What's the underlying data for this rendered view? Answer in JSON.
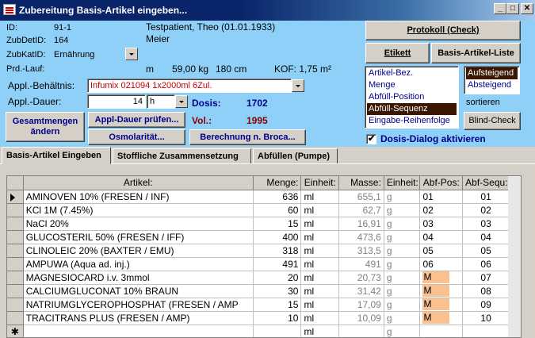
{
  "window": {
    "title": "Zubereitung Basis-Artikel eingeben...",
    "minimize": "_",
    "maximize": "□",
    "close": "✕"
  },
  "patient": {
    "id_label": "ID:",
    "id_value": "91-1",
    "name": "Testpatient, Theo (01.01.1933)",
    "zubdet_label": "ZubDetID:",
    "zubdet_value": "164",
    "doctor": "Meier",
    "zubkat_label": "ZubKatID:",
    "zubkat_value": "Ernährung",
    "prdlauf_label": "Prd.-Lauf:",
    "unit_m": "m",
    "weight": "59,00 kg",
    "height": "180 cm",
    "kof": "KOF: 1,75 m²"
  },
  "appl": {
    "behaeltnis_label": "Appl.-Behältnis:",
    "behaeltnis_value": "Infumix 021094 1x2000ml 6Zul.",
    "dauer_label": "Appl.-Dauer:",
    "dauer_value": "14",
    "dauer_unit": "h",
    "dosis_label": "Dosis:",
    "dosis_value": "1702",
    "vol_label": "Vol.:",
    "vol_value": "1995"
  },
  "buttons": {
    "gesamtmengen": "Gesamtmengen ändern",
    "appl_dauer": "Appl-Dauer prüfen...",
    "osmolaritaet": "Osmolarität...",
    "berechnung": "Berechnung n. Broca...",
    "protokoll": "Protokoll (Check)",
    "etikett": "Etikett",
    "basis_liste": "Basis-Artikel-Liste",
    "blind_check": "Blind-Check"
  },
  "sort": {
    "fields": [
      "Artikel-Bez.",
      "Menge",
      "Abfüll-Position",
      "Abfüll-Sequenz",
      "Eingabe-Reihenfolge"
    ],
    "selected_field": "Abfüll-Sequenz",
    "orders": [
      "Aufsteigend",
      "Absteigend"
    ],
    "selected_order": "Aufsteigend",
    "label": "sortieren"
  },
  "dosis_dialog": {
    "label": "Dosis-Dialog aktivieren",
    "checked": true,
    "mark": "✔"
  },
  "tabs": [
    "Basis-Artikel Eingeben",
    "Stoffliche Zusammensetzung",
    "Abfüllen (Pumpe)"
  ],
  "table": {
    "headers": [
      "Artikel:",
      "Menge:",
      "Einheit:",
      "Masse:",
      "Einheit:",
      "Abf-Pos:",
      "Abf-Sequ:"
    ],
    "rows": [
      {
        "artikel": "AMINOVEN 10% (FRESEN / INF)",
        "menge": "636",
        "einheit": "ml",
        "masse": "655,1",
        "einheit2": "g",
        "pos": "01",
        "seq": "01"
      },
      {
        "artikel": "KCl 1M (7.45%)",
        "menge": "60",
        "einheit": "ml",
        "masse": "62,7",
        "einheit2": "g",
        "pos": "02",
        "seq": "02"
      },
      {
        "artikel": "NaCl 20%",
        "menge": "15",
        "einheit": "ml",
        "masse": "16,91",
        "einheit2": "g",
        "pos": "03",
        "seq": "03"
      },
      {
        "artikel": "GLUCOSTERIL 50%  (FRESEN / IFF)",
        "menge": "400",
        "einheit": "ml",
        "masse": "473,6",
        "einheit2": "g",
        "pos": "04",
        "seq": "04"
      },
      {
        "artikel": "CLINOLEIC 20% (BAXTER / EMU)",
        "menge": "318",
        "einheit": "ml",
        "masse": "313,5",
        "einheit2": "g",
        "pos": "05",
        "seq": "05"
      },
      {
        "artikel": "AMPUWA (Aqua ad. inj.)",
        "menge": "491",
        "einheit": "ml",
        "masse": "491",
        "einheit2": "g",
        "pos": "06",
        "seq": "06"
      },
      {
        "artikel": "MAGNESIOCARD i.v. 3mmol",
        "menge": "20",
        "einheit": "ml",
        "masse": "20,73",
        "einheit2": "g",
        "pos": "M",
        "seq": "07"
      },
      {
        "artikel": "CALCIUMGLUCONAT 10% BRAUN",
        "menge": "30",
        "einheit": "ml",
        "masse": "31,42",
        "einheit2": "g",
        "pos": "M",
        "seq": "08"
      },
      {
        "artikel": "NATRIUMGLYCEROPHOSPHAT (FRESEN / AMP",
        "menge": "15",
        "einheit": "ml",
        "masse": "17,09",
        "einheit2": "g",
        "pos": "M",
        "seq": "09"
      },
      {
        "artikel": "TRACITRANS PLUS (FRESEN / AMP)",
        "menge": "10",
        "einheit": "ml",
        "masse": "10,09",
        "einheit2": "g",
        "pos": "M",
        "seq": "10"
      }
    ],
    "new_row": {
      "marker": "✱",
      "einheit": "ml",
      "einheit2": "g"
    }
  },
  "colors": {
    "header_bg": "#8fd0f8",
    "highlight": "#fac090",
    "selected": "#3b1700"
  }
}
